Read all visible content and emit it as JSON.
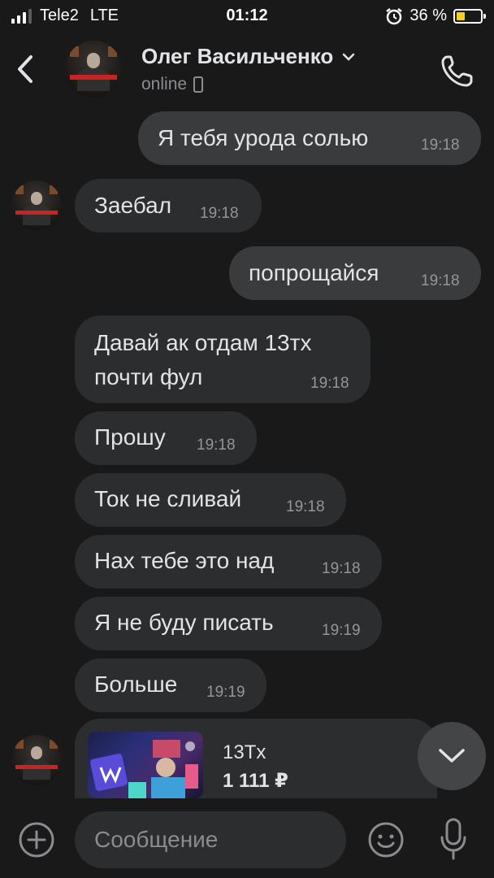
{
  "status_bar": {
    "carrier": "Tele2",
    "network": "LTE",
    "time": "01:12",
    "battery_percent": "36 %",
    "battery_level": 0.36
  },
  "header": {
    "name": "Олег Васильченко",
    "status": "online"
  },
  "messages": [
    {
      "text": "Я тебя урода солью",
      "time": "19:18",
      "outgoing": true
    },
    {
      "text": "Заебал",
      "time": "19:18",
      "outgoing": false
    },
    {
      "text": "попрощайся",
      "time": "19:18",
      "outgoing": true
    },
    {
      "line1": "Давай ак отдам 13тх",
      "line2": "почти фул",
      "time": "19:18",
      "outgoing": false
    },
    {
      "text": "Прошу",
      "time": "19:18",
      "outgoing": false
    },
    {
      "text": "Ток не сливай",
      "time": "19:18",
      "outgoing": false
    },
    {
      "text": "Нах тебе это над",
      "time": "19:18",
      "outgoing": false
    },
    {
      "text": "Я не буду писать",
      "time": "19:19",
      "outgoing": false
    },
    {
      "text": "Больше",
      "time": "19:19",
      "outgoing": false
    }
  ],
  "product": {
    "title": "13Tx",
    "price": "1 111 ₽"
  },
  "composer": {
    "placeholder": "Сообщение"
  },
  "colors": {
    "background": "#19191a",
    "bubble": "#2c2d2e",
    "text": "#e1e3e6",
    "muted": "#939598",
    "battery": "#f5d023"
  },
  "icons": [
    "signal-icon",
    "alarm-icon",
    "battery-icon",
    "back-icon",
    "chevron-down-icon",
    "phone-call-icon",
    "scroll-down-icon",
    "plus-icon",
    "emoji-icon",
    "microphone-icon"
  ]
}
